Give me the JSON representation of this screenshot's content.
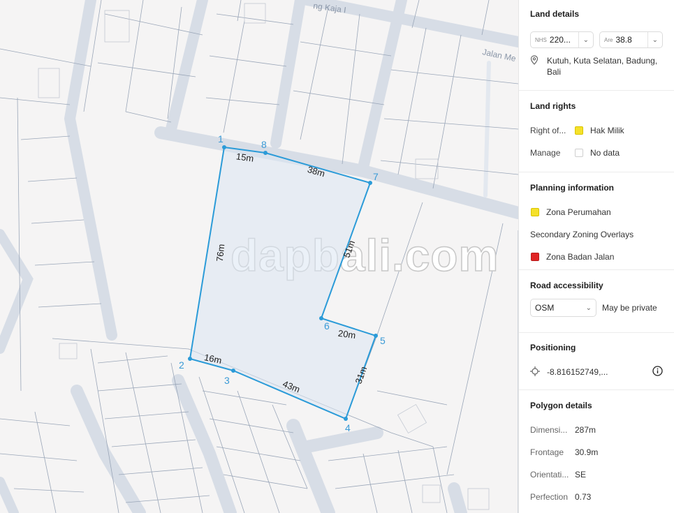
{
  "map": {
    "road_labels": [
      "ng Kaja I",
      "Jalan Me"
    ],
    "vertices": [
      "1",
      "2",
      "3",
      "4",
      "5",
      "6",
      "7",
      "8"
    ],
    "measurements": [
      "15m",
      "38m",
      "51m",
      "20m",
      "31m",
      "43m",
      "16m",
      "76m"
    ],
    "watermark": "dapbali.com",
    "colors": {
      "polygon_stroke": "#2b9bd8",
      "polygon_fill": "#dbe5f3",
      "road": "#d7dde6",
      "parcel_line": "#9aa6b8"
    }
  },
  "panel": {
    "land_details": {
      "title": "Land details",
      "nib_tag": "NHS",
      "nib_value": "220...",
      "area_tag": "Are",
      "area_value": "38.8",
      "address": "Kutuh, Kuta Selatan, Badung, Bali"
    },
    "land_rights": {
      "title": "Land rights",
      "rows": [
        {
          "label": "Right of...",
          "value": "Hak Milik",
          "color": "#f5e12a"
        },
        {
          "label": "Manage",
          "value": "No data",
          "color": "#ffffff"
        }
      ]
    },
    "planning": {
      "title": "Planning information",
      "zone": {
        "label": "Zona Perumahan",
        "color": "#f5e12a"
      },
      "overlay_title": "Secondary Zoning Overlays",
      "overlay": {
        "label": "Zona Badan Jalan",
        "color": "#e02424"
      }
    },
    "road_access": {
      "title": "Road accessibility",
      "select_value": "OSM",
      "note": "May be private"
    },
    "positioning": {
      "title": "Positioning",
      "coords": "-8.816152749,..."
    },
    "polygon": {
      "title": "Polygon details",
      "rows": [
        {
          "label": "Dimensi...",
          "value": "287m"
        },
        {
          "label": "Frontage",
          "value": "30.9m"
        },
        {
          "label": "Orientati...",
          "value": "SE"
        },
        {
          "label": "Perfection",
          "value": "0.73"
        }
      ]
    }
  }
}
